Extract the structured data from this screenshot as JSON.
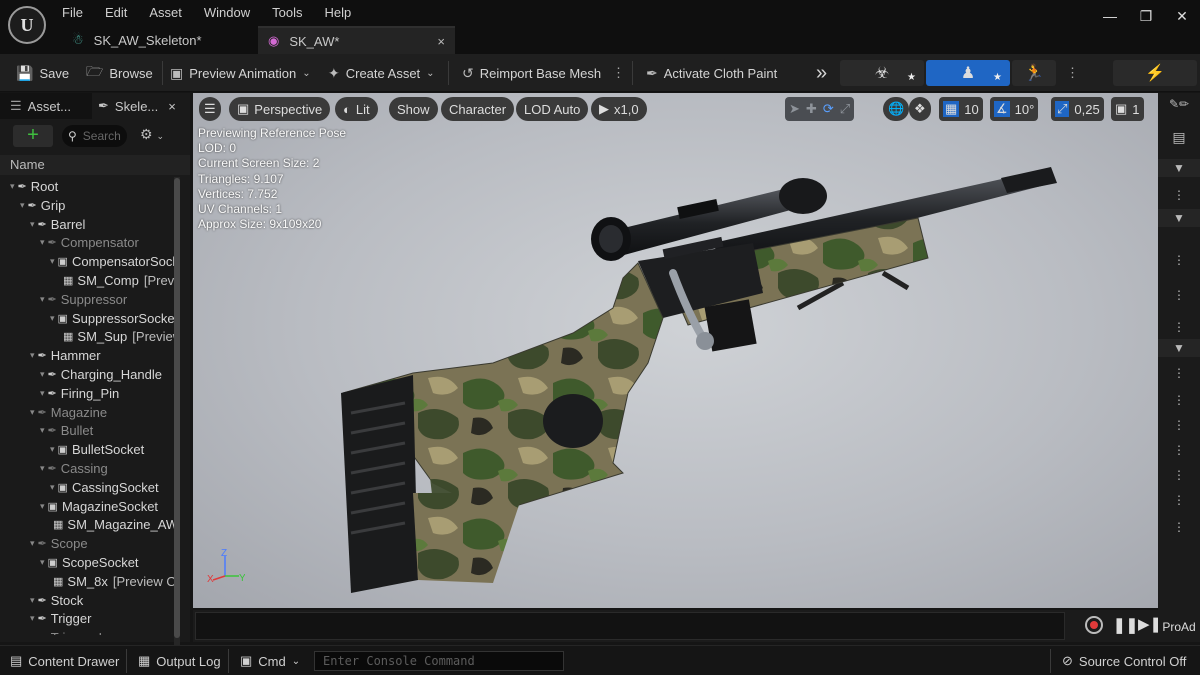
{
  "menu": [
    "File",
    "Edit",
    "Asset",
    "Window",
    "Tools",
    "Help"
  ],
  "tabs": [
    {
      "label": "SK_AW_Skeleton*",
      "icon": "skeleton-icon"
    },
    {
      "label": "SK_AW*",
      "icon": "skeletal-mesh-icon",
      "close": "×"
    }
  ],
  "window_controls": {
    "minimize": "—",
    "restore": "❐",
    "close": "✕"
  },
  "toolbar": {
    "save": "Save",
    "browse": "Browse",
    "preview_animation": "Preview Animation",
    "create_asset": "Create Asset",
    "reimport": "Reimport Base Mesh",
    "cloth_paint": "Activate Cloth Paint",
    "more": "»"
  },
  "left_panel": {
    "tabs": [
      "Asset...",
      "Skele..."
    ],
    "close": "×",
    "search_placeholder": "Search",
    "column_header": "Name",
    "tree": [
      {
        "label": "Root",
        "type": "bone",
        "depth": 0,
        "dim": false
      },
      {
        "label": "Grip",
        "type": "bone",
        "depth": 1,
        "dim": false
      },
      {
        "label": "Barrel",
        "type": "bone",
        "depth": 2,
        "dim": false
      },
      {
        "label": "Compensator",
        "type": "bone",
        "depth": 3,
        "dim": true
      },
      {
        "label": "CompensatorSocket",
        "type": "socket",
        "depth": 4,
        "dim": false
      },
      {
        "label": "SM_Comp",
        "suffix": "[Preview]",
        "type": "mesh",
        "depth": 5,
        "dim": false
      },
      {
        "label": "Suppressor",
        "type": "bone",
        "depth": 3,
        "dim": true
      },
      {
        "label": "SuppressorSocket",
        "type": "socket",
        "depth": 4,
        "dim": false
      },
      {
        "label": "SM_Sup",
        "suffix": "[Preview]",
        "type": "mesh",
        "depth": 5,
        "dim": false
      },
      {
        "label": "Hammer",
        "type": "bone",
        "depth": 2,
        "dim": false
      },
      {
        "label": "Charging_Handle",
        "type": "bone",
        "depth": 3,
        "dim": false
      },
      {
        "label": "Firing_Pin",
        "type": "bone",
        "depth": 3,
        "dim": false
      },
      {
        "label": "Magazine",
        "type": "bone",
        "depth": 2,
        "dim": true
      },
      {
        "label": "Bullet",
        "type": "bone",
        "depth": 3,
        "dim": true
      },
      {
        "label": "BulletSocket",
        "type": "socket",
        "depth": 4,
        "dim": false
      },
      {
        "label": "Cassing",
        "type": "bone",
        "depth": 3,
        "dim": true
      },
      {
        "label": "CassingSocket",
        "type": "socket",
        "depth": 4,
        "dim": false
      },
      {
        "label": "MagazineSocket",
        "type": "socket",
        "depth": 3,
        "dim": false
      },
      {
        "label": "SM_Magazine_AW",
        "suffix": "",
        "type": "mesh",
        "depth": 4,
        "dim": false
      },
      {
        "label": "Scope",
        "type": "bone",
        "depth": 2,
        "dim": true
      },
      {
        "label": "ScopeSocket",
        "type": "socket",
        "depth": 3,
        "dim": false
      },
      {
        "label": "SM_8x",
        "suffix": "[Preview Only]",
        "type": "mesh",
        "depth": 4,
        "dim": false
      },
      {
        "label": "Stock",
        "type": "bone",
        "depth": 2,
        "dim": false
      },
      {
        "label": "Trigger",
        "type": "bone",
        "depth": 2,
        "dim": false
      },
      {
        "label": "Trigger_L",
        "type": "bone",
        "depth": 2,
        "dim": true
      }
    ]
  },
  "viewport": {
    "perspective": "Perspective",
    "lit": "Lit",
    "show": "Show",
    "character": "Character",
    "lod": "LOD Auto",
    "play_speed": "x1,0",
    "grid_snap": "10",
    "rot_snap": "10°",
    "scale_snap": "0,25",
    "camera_speed": "1",
    "stats": [
      "Previewing Reference Pose",
      "LOD: 0",
      "Current Screen Size: 2",
      "Triangles: 9.107",
      "Vertices: 7.752",
      "UV Channels: 1",
      "Approx Size: 9x109x20"
    ]
  },
  "right_panel": {
    "label": "ProAd"
  },
  "status_bar": {
    "content_drawer": "Content Drawer",
    "output_log": "Output Log",
    "cmd": "Cmd",
    "console_placeholder": "Enter Console Command",
    "source_control": "Source Control Off"
  },
  "colors": {
    "accent_blue": "#1f66c4",
    "green": "#3fbf3f",
    "record_red": "#e03a3a"
  }
}
